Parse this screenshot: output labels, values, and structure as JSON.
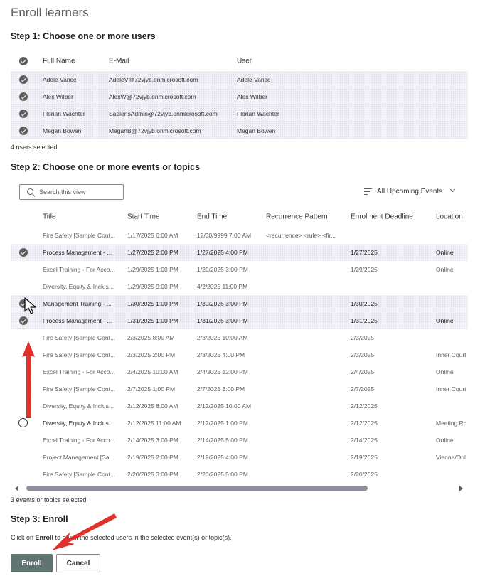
{
  "title": "Enroll learners",
  "step1": {
    "title": "Step 1: Choose one or more users",
    "columns": [
      "Full Name",
      "E-Mail",
      "User"
    ],
    "rows": [
      {
        "name": "Adele Vance",
        "email": "AdeleV@72vjyb.onmicrosoft.com",
        "user": "Adele Vance",
        "selected": true
      },
      {
        "name": "Alex Wilber",
        "email": "AlexW@72vjyb.onmicrosoft.com",
        "user": "Alex Wilber",
        "selected": true
      },
      {
        "name": "Florian Wachter",
        "email": "SapiensAdmin@72vjyb.onmicrosoft.com",
        "user": "Florian Wachter",
        "selected": true
      },
      {
        "name": "Megan Bowen",
        "email": "MeganB@72vjyb.onmicrosoft.com",
        "user": "Megan Bowen",
        "selected": true
      }
    ],
    "status": "4 users selected"
  },
  "step2": {
    "title": "Step 2: Choose one or more events or topics",
    "search_placeholder": "Search this view",
    "view_label": "All Upcoming Events",
    "columns": [
      "Title",
      "Start Time",
      "End Time",
      "Recurrence Pattern",
      "Enrolment Deadline",
      "Location"
    ],
    "rows": [
      {
        "title": "Fire Safety [Sample Cont...",
        "start": "1/17/2025 6:00 AM",
        "end": "12/30/9999 7:00 AM",
        "recurrence": "<recurrence> <rule> <fir...",
        "deadline": "",
        "location": "",
        "state": "none"
      },
      {
        "title": "Process Management - ...",
        "start": "1/27/2025 2:00 PM",
        "end": "1/27/2025 4:00 PM",
        "recurrence": "",
        "deadline": "1/27/2025",
        "location": "Online",
        "state": "selected"
      },
      {
        "title": "Excel Training - For Acco...",
        "start": "1/29/2025 1:00 PM",
        "end": "1/29/2025 3:00 PM",
        "recurrence": "",
        "deadline": "1/29/2025",
        "location": "Online",
        "state": "none"
      },
      {
        "title": "Diversity, Equity & Inclus...",
        "start": "1/29/2025 9:00 PM",
        "end": "4/2/2025 11:00 PM",
        "recurrence": "",
        "deadline": "",
        "location": "",
        "state": "none"
      },
      {
        "title": "Management Training - ...",
        "start": "1/30/2025 1:00 PM",
        "end": "1/30/2025 3:00 PM",
        "recurrence": "",
        "deadline": "1/30/2025",
        "location": "",
        "state": "selected"
      },
      {
        "title": "Process Management - ...",
        "start": "1/31/2025 1:00 PM",
        "end": "1/31/2025 3:00 PM",
        "recurrence": "",
        "deadline": "1/31/2025",
        "location": "Online",
        "state": "selected"
      },
      {
        "title": "Fire Safety [Sample Cont...",
        "start": "2/3/2025 8:00 AM",
        "end": "2/3/2025 10:00 AM",
        "recurrence": "",
        "deadline": "2/3/2025",
        "location": "",
        "state": "none"
      },
      {
        "title": "Fire Safety [Sample Cont...",
        "start": "2/3/2025 2:00 PM",
        "end": "2/3/2025 4:00 PM",
        "recurrence": "",
        "deadline": "2/3/2025",
        "location": "Inner Court",
        "state": "none"
      },
      {
        "title": "Excel Training - For Acco...",
        "start": "2/4/2025 10:00 AM",
        "end": "2/4/2025 12:00 PM",
        "recurrence": "",
        "deadline": "2/4/2025",
        "location": "Online",
        "state": "none"
      },
      {
        "title": "Fire Safety [Sample Cont...",
        "start": "2/7/2025 1:00 PM",
        "end": "2/7/2025 3:00 PM",
        "recurrence": "",
        "deadline": "2/7/2025",
        "location": "Inner Court",
        "state": "none"
      },
      {
        "title": "Diversity, Equity & Inclus...",
        "start": "2/12/2025 8:00 AM",
        "end": "2/12/2025 10:00 AM",
        "recurrence": "",
        "deadline": "2/12/2025",
        "location": "",
        "state": "none"
      },
      {
        "title": "Diversity, Equity & Inclus...",
        "start": "2/12/2025 11:00 AM",
        "end": "2/12/2025 1:00 PM",
        "recurrence": "",
        "deadline": "2/12/2025",
        "location": "Meeting Rc",
        "state": "hover"
      },
      {
        "title": "Excel Training - For Acco...",
        "start": "2/14/2025 3:00 PM",
        "end": "2/14/2025 5:00 PM",
        "recurrence": "",
        "deadline": "2/14/2025",
        "location": "Online",
        "state": "none"
      },
      {
        "title": "Project Management [Sa...",
        "start": "2/19/2025 2:00 PM",
        "end": "2/19/2025 4:00 PM",
        "recurrence": "",
        "deadline": "2/19/2025",
        "location": "Vienna/Onl",
        "state": "none"
      },
      {
        "title": "Fire Safety [Sample Cont...",
        "start": "2/20/2025 3:00 PM",
        "end": "2/20/2025 5:00 PM",
        "recurrence": "",
        "deadline": "2/20/2025",
        "location": "",
        "state": "none"
      }
    ],
    "status": "3 events or topics selected"
  },
  "step3": {
    "title": "Step 3: Enroll",
    "instruction_prefix": "Click on ",
    "instruction_bold": "Enroll",
    "instruction_suffix": " to enroll the selected users in the selected event(s) or topic(s).",
    "enroll_label": "Enroll",
    "cancel_label": "Cancel"
  },
  "colors": {
    "accent": "#5f7470",
    "selected_row": "#f1f0f6",
    "annotation_arrow": "#e0312b"
  }
}
